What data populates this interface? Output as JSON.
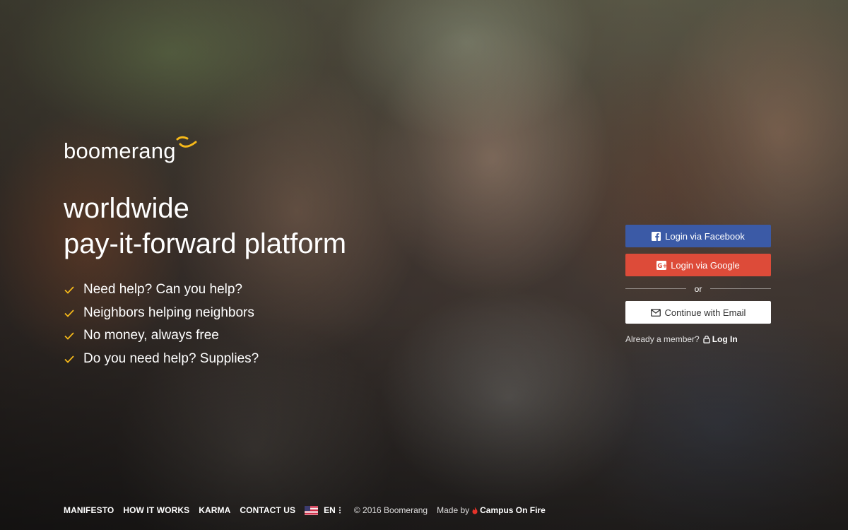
{
  "brand": {
    "name": "boomerang",
    "mark_color": "#f6b91a"
  },
  "hero": {
    "headline_line1": "worldwide",
    "headline_line2": "pay-it-forward platform",
    "features": [
      "Need help? Can you help?",
      "Neighbors helping neighbors",
      "No money, always free",
      "Do you need help? Supplies?"
    ],
    "check_color": "#f6b91a"
  },
  "auth": {
    "facebook_label": "Login via Facebook",
    "google_label": "Login via Google",
    "or_label": "or",
    "email_label": "Continue with Email",
    "already_member": "Already a member?",
    "login_label": "Log In",
    "facebook_color": "#3b5aa6",
    "google_color": "#dd4b39"
  },
  "footer": {
    "nav": [
      "MANIFESTO",
      "HOW IT WORKS",
      "KARMA",
      "CONTACT US"
    ],
    "language": "EN",
    "copyright": "© 2016 Boomerang",
    "made_by": "Made by",
    "maker": "Campus On Fire",
    "maker_icon_color": "#e5332a"
  },
  "icons": [
    "boomerang-logo-icon",
    "check-icon",
    "facebook-icon",
    "google-plus-icon",
    "mail-icon",
    "lock-icon",
    "us-flag-icon",
    "more-vertical-icon",
    "flame-icon"
  ]
}
